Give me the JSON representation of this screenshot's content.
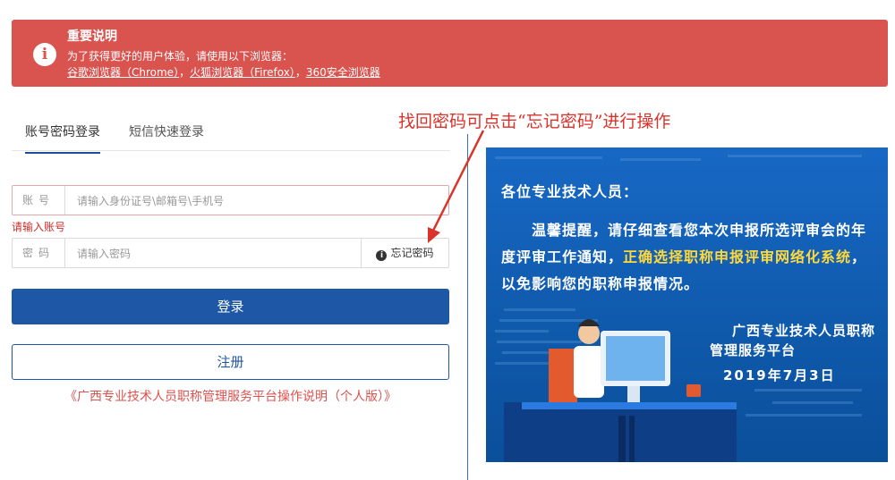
{
  "alert": {
    "title": "重要说明",
    "description": "为了获得更好的用户体验，请使用以下浏览器：",
    "links": [
      "谷歌浏览器（Chrome）",
      "火狐浏览器（Firefox）",
      "360安全浏览器"
    ],
    "separator": "，"
  },
  "tabs": [
    "账号密码登录",
    "短信快速登录"
  ],
  "account": {
    "label": "账号",
    "placeholder": "请输入身份证号\\邮箱号\\手机号",
    "error": "请输入账号"
  },
  "password": {
    "label": "密码",
    "placeholder": "请输入密码",
    "forgot_label": "忘记密码"
  },
  "buttons": {
    "login": "登录",
    "register": "注册"
  },
  "manual_link": "《广西专业技术人员职称管理服务平台操作说明（个人版）》",
  "annotation": "找回密码可点击“忘记密码”进行操作",
  "notice": {
    "greeting": "各位专业技术人员：",
    "body_before": "温馨提醒，请仔细查看您本次申报所选评审会的年度评审工作通知，",
    "body_highlight": "正确选择职称申报评审网络化系统",
    "body_after": "，以免影响您的职称申报情况。",
    "sign_line1": "广西专业技术人员职称",
    "sign_line2": "管理服务平台",
    "date": "2019年7月3日"
  },
  "colors": {
    "alert_bg": "#d9534f",
    "primary": "#1e57a6",
    "notice_bg": "#0d5fb0",
    "highlight": "#ffd93b",
    "annotation": "#d9332b"
  }
}
